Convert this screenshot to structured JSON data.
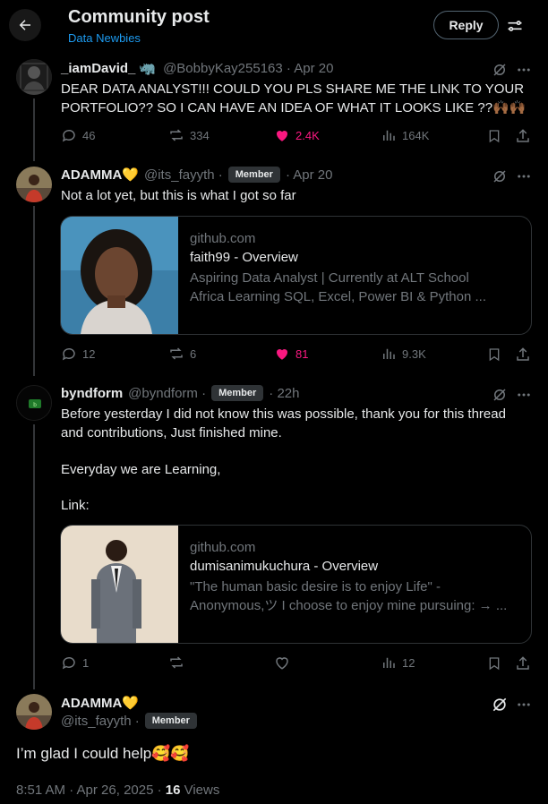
{
  "header": {
    "title": "Community post",
    "community": "Data Newbies",
    "reply_label": "Reply",
    "back_icon": "arrow-left-icon",
    "settings_icon": "sliders-icon"
  },
  "posts": [
    {
      "display_name": "_iamDavid_",
      "name_emoji": "🦏",
      "handle": "@BobbyKay255163 · Apr 20",
      "text": "DEAR DATA ANALYST!!! COULD YOU PLS SHARE ME THE LINK TO YOUR PORTFOLIO?? SO I CAN HAVE AN IDEA OF WHAT IT LOOKS LIKE ??🙌🏾🙌🏾",
      "replies": "46",
      "reposts": "334",
      "likes": "2.4K",
      "views": "164K"
    },
    {
      "display_name": "ADAMMA💛",
      "handle": "@its_fayyth ·",
      "badge": "Member",
      "date": "· Apr 20",
      "text": "Not a lot yet, but this is what I got so far",
      "card": {
        "domain": "github.com",
        "title": "faith99 - Overview",
        "desc_line1": "Aspiring Data Analyst | Currently at ALT School",
        "desc_line2": "Africa Learning SQL, Excel, Power BI & Python ..."
      },
      "replies": "12",
      "reposts": "6",
      "likes": "81",
      "views": "9.3K"
    },
    {
      "display_name": "byndform",
      "handle": "@byndform ·",
      "badge": "Member",
      "date": "· 22h",
      "text_line1": "Before yesterday I did not know this was possible, thank you for this thread",
      "text_line2": "and contributions, Just finished mine.",
      "text_line3": "Everyday we are Learning,",
      "text_line4": "Link:",
      "card": {
        "domain": "github.com",
        "title": "dumisanimukuchura - Overview",
        "desc_line1": "\"The human basic desire is to enjoy Life\" -",
        "desc_line2": "Anonymous,ツ I choose to enjoy mine pursuing: → ..."
      },
      "replies": "1",
      "views": "12"
    }
  ],
  "main_post": {
    "display_name": "ADAMMA💛",
    "handle": "@its_fayyth ·",
    "badge": "Member",
    "text": "I’m glad I could help🥰🥰",
    "timestamp": "8:51 AM · Apr 26, 2025 · ",
    "view_count": "16",
    "views_label": " Views"
  },
  "colors": {
    "like_active": "#f91880",
    "link_blue": "#1d9bf0",
    "muted": "#71767b"
  }
}
